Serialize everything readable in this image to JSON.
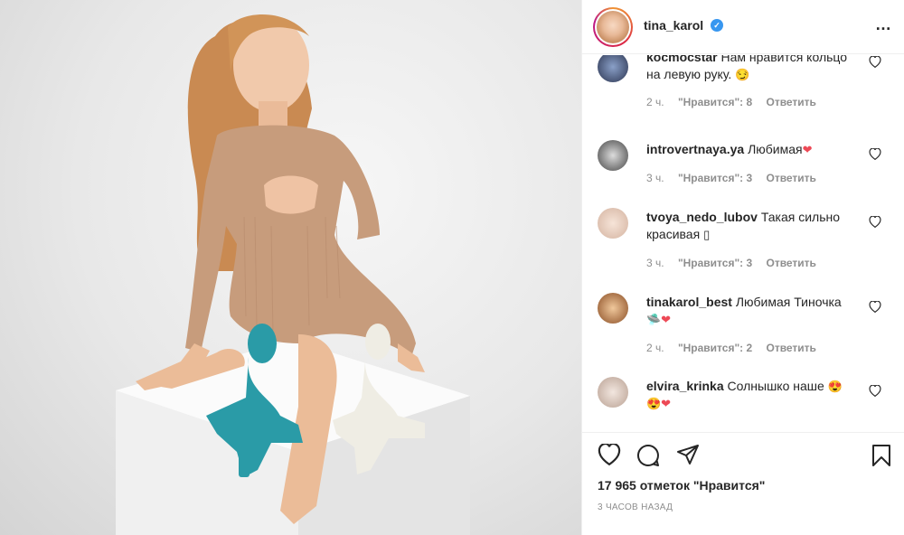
{
  "post": {
    "username": "tina_karol",
    "verified_mark": "✓",
    "more_icon": "…",
    "likes": "17 965 отметок \"Нравится\"",
    "time_ago": "3 ЧАСОВ НАЗАД"
  },
  "comments": [
    {
      "user": "kocmocstar",
      "text": "Нам нравится кольцо на левую руку.",
      "emoji": "😏",
      "time": "2 ч.",
      "likes": "\"Нравится\": 8",
      "reply": "Ответить",
      "avatar_color": "#5a6a88"
    },
    {
      "user": "introvertnaya.ya",
      "text": "Любимая",
      "emoji": "❤",
      "time": "3 ч.",
      "likes": "\"Нравится\": 3",
      "reply": "Ответить",
      "avatar_color": "#9a9a9a"
    },
    {
      "user": "tvoya_nedo_lubov",
      "text": "Такая сильно красивая",
      "emoji": "▯",
      "time": "3 ч.",
      "likes": "\"Нравится\": 3",
      "reply": "Ответить",
      "avatar_color": "#e8d3c6"
    },
    {
      "user": "tinakarol_best",
      "text": "Любимая Тиночка",
      "emoji": "🛸❤",
      "time": "2 ч.",
      "likes": "\"Нравится\": 2",
      "reply": "Ответить",
      "avatar_color": "#c98a52"
    },
    {
      "user": "elvira_krinka",
      "text": "Солнышко наше",
      "emoji": "😍",
      "emoji2": "😍❤",
      "avatar_color": "#d9c7bd"
    }
  ],
  "icons": {
    "like": "heart-icon",
    "comment": "comment-icon",
    "share": "share-icon",
    "save": "bookmark-icon"
  },
  "colors": {
    "verified": "#3897f0",
    "heart_red": "#ed4956",
    "muted": "#8e8e8e"
  }
}
